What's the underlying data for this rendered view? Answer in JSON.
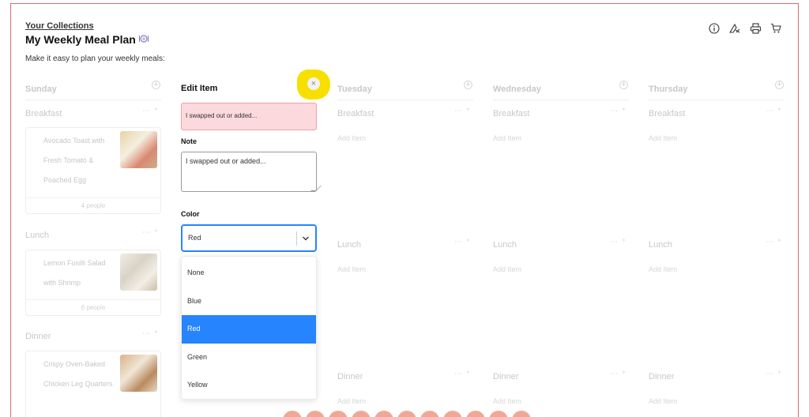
{
  "header": {
    "breadcrumb": "Your Collections",
    "title": "My Weekly Meal Plan",
    "subtitle": "Make it easy to plan your weekly meals:",
    "tools": [
      "info-icon",
      "no-cook-icon",
      "print-icon",
      "cart-icon"
    ]
  },
  "days": {
    "sunday": "Sunday",
    "tuesday": "Tuesday",
    "wednesday": "Wednesday",
    "thursday": "Thursday"
  },
  "meals": {
    "breakfast": "Breakfast",
    "lunch": "Lunch",
    "dinner": "Dinner",
    "add_item": "Add Item"
  },
  "cards": {
    "breakfast": {
      "name": "Avocado Toast with Fresh Tomato & Poached Egg",
      "servings": "4 people"
    },
    "lunch": {
      "name": "Lemon Fusilli Salad with Shrimp",
      "servings": "6 people"
    },
    "dinner": {
      "name": "Crispy Oven-Baked Chicken Leg Quarters"
    }
  },
  "edit": {
    "title": "Edit Item",
    "close": "×",
    "item_text": "I swapped out or added...",
    "note_label": "Note",
    "note_value": "I swapped out or added...",
    "color_label": "Color",
    "color_value": "Red",
    "options": [
      "None",
      "Blue",
      "Red",
      "Green",
      "Yellow"
    ],
    "selected_option": "Red"
  },
  "colors": {
    "accent": "#2684ff",
    "brand": "#e26a6a",
    "highlight": "#f7e000",
    "error_bg": "#fcd9dc"
  }
}
